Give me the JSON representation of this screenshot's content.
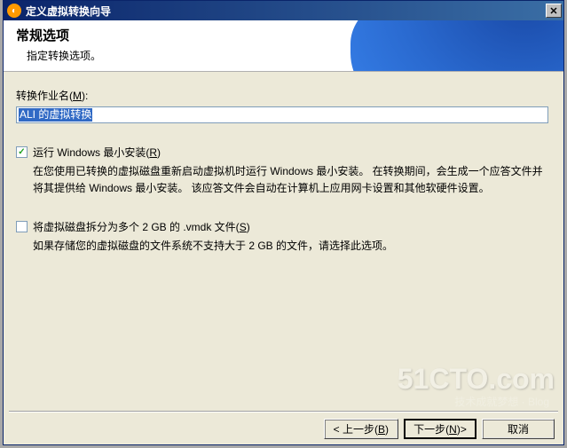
{
  "window": {
    "title": "定义虚拟转换向导"
  },
  "header": {
    "title": "常规选项",
    "subtitle": "指定转换选项。"
  },
  "form": {
    "conversion_job_label_pre": "转换作业名(",
    "conversion_job_hotkey": "M",
    "conversion_job_label_post": "):",
    "conversion_job_value": "ALI 的虚拟转换"
  },
  "option1": {
    "checked": true,
    "label_pre": "运行 Windows 最小安装(",
    "hotkey": "R",
    "label_post": ")",
    "description": "在您使用已转换的虚拟磁盘重新启动虚拟机时运行 Windows 最小安装。 在转换期间，会生成一个应答文件并将其提供给 Windows 最小安装。 该应答文件会自动在计算机上应用网卡设置和其他软硬件设置。"
  },
  "option2": {
    "checked": false,
    "label_pre": "将虚拟磁盘拆分为多个 2 GB 的 .vmdk 文件(",
    "hotkey": "S",
    "label_post": ")",
    "description": "如果存储您的虚拟磁盘的文件系统不支持大于 2 GB 的文件，请选择此选项。"
  },
  "buttons": {
    "back_pre": "< 上一步(",
    "back_hotkey": "B",
    "back_post": ")",
    "next_pre": "下一步(",
    "next_hotkey": "N",
    "next_post": ")>",
    "cancel": "取消"
  },
  "watermark": {
    "main": "51CTO.com",
    "sub": "技术成就梦想 · Blog"
  }
}
